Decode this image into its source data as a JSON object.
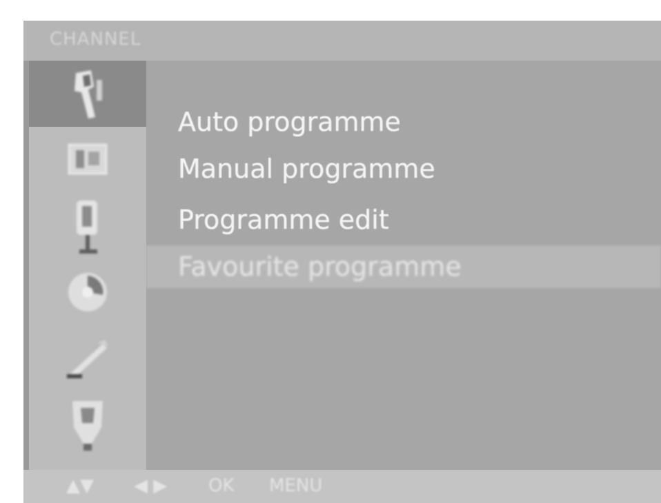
{
  "window": {
    "title": "CHANNEL"
  },
  "sidebar": {
    "icons": [
      {
        "name": "station-icon",
        "selected": true
      },
      {
        "name": "picture-icon",
        "selected": false
      },
      {
        "name": "sound-icon",
        "selected": false
      },
      {
        "name": "clock-icon",
        "selected": false
      },
      {
        "name": "special-icon",
        "selected": false
      },
      {
        "name": "screen-icon",
        "selected": false
      }
    ]
  },
  "menu": {
    "items": [
      {
        "label": "Auto programme",
        "highlighted": false
      },
      {
        "label": "Manual programme",
        "highlighted": false
      },
      {
        "label": "Programme edit",
        "highlighted": false
      },
      {
        "label": "Favourite programme",
        "highlighted": true
      }
    ]
  },
  "nav": {
    "updown": "▲▼",
    "leftright": "◀ ▶",
    "ok": "OK",
    "menu": "MENU"
  },
  "colors": {
    "panel": "#a6a6a6",
    "sidebar": "#bcbcbc",
    "selected_icon_bg": "#8a8a8a",
    "highlight_row": "#b7b7b7",
    "text": "#f4f4f4"
  }
}
